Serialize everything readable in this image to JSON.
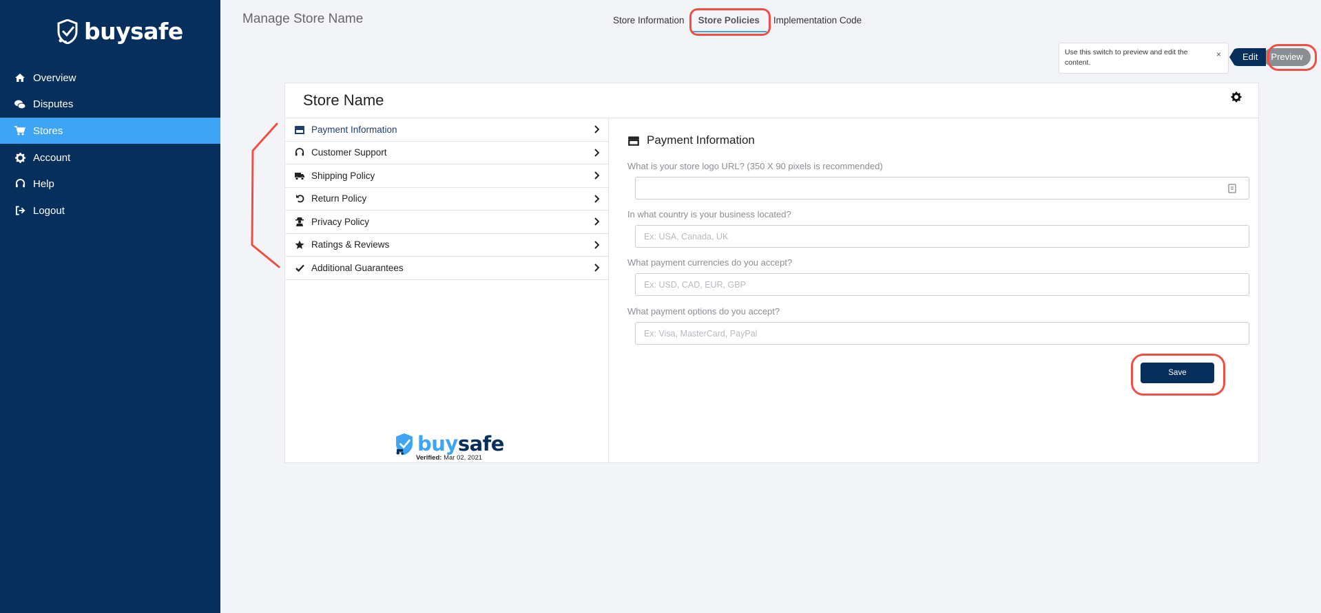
{
  "app": {
    "brand": "buysafe"
  },
  "sidebar": {
    "items": [
      {
        "label": "Overview",
        "icon": "home-icon"
      },
      {
        "label": "Disputes",
        "icon": "comments-icon"
      },
      {
        "label": "Stores",
        "icon": "cart-icon"
      },
      {
        "label": "Account",
        "icon": "gear-icon"
      },
      {
        "label": "Help",
        "icon": "headset-icon"
      },
      {
        "label": "Logout",
        "icon": "sign-out-icon"
      }
    ],
    "active": "Stores"
  },
  "header": {
    "title": "Manage Store Name",
    "tabs": [
      {
        "label": "Store Information"
      },
      {
        "label": "Store Policies"
      },
      {
        "label": "Implementation Code"
      }
    ],
    "active_tab": "Store Policies"
  },
  "tooltip": {
    "text": "Use this switch to preview and edit the content.",
    "close": "×"
  },
  "mode_switch": {
    "edit_label": "Edit",
    "preview_label": "Preview"
  },
  "card": {
    "title": "Store Name",
    "policies": [
      {
        "label": "Payment Information",
        "icon": "store-icon"
      },
      {
        "label": "Customer Support",
        "icon": "headset-icon"
      },
      {
        "label": "Shipping Policy",
        "icon": "truck-icon"
      },
      {
        "label": "Return Policy",
        "icon": "undo-icon"
      },
      {
        "label": "Privacy Policy",
        "icon": "user-secret-icon"
      },
      {
        "label": "Ratings & Reviews",
        "icon": "star-icon"
      },
      {
        "label": "Additional Guarantees",
        "icon": "check-icon"
      }
    ],
    "footer": {
      "brand_buy": "buy",
      "brand_safe": "safe",
      "verified_label": "Verified:",
      "verified_date": "Mar 02, 2021"
    }
  },
  "form": {
    "section_title": "Payment Information",
    "questions": [
      {
        "label": "What is your store logo URL? (350 X 90 pixels is recommended)",
        "placeholder": ""
      },
      {
        "label": "In what country is your business located?",
        "placeholder": "Ex: USA, Canada, UK"
      },
      {
        "label": "What payment currencies do you accept?",
        "placeholder": "Ex: USD, CAD, EUR, GBP"
      },
      {
        "label": "What payment options do you accept?",
        "placeholder": "Ex: Visa, MasterCard, PayPal"
      }
    ],
    "save_label": "Save"
  },
  "colors": {
    "sidebar_bg": "#062f5c",
    "accent": "#3da5f4",
    "highlight": "#f04e43"
  }
}
